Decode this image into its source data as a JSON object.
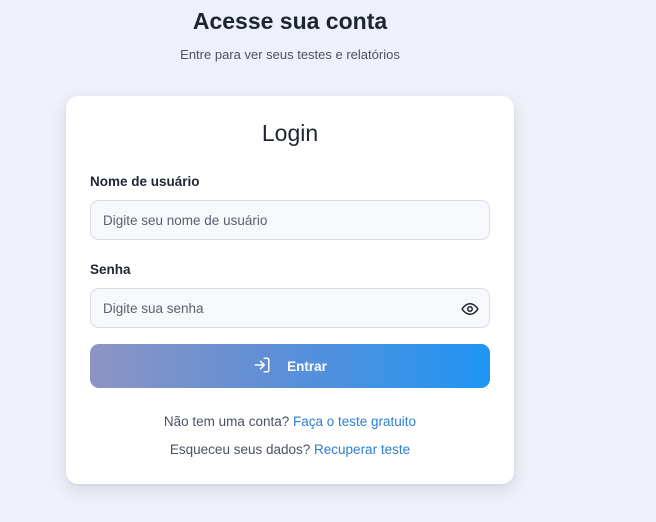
{
  "header": {
    "title": "Acesse sua conta",
    "subtitle": "Entre para ver seus testes e relatórios"
  },
  "login_card": {
    "title": "Login",
    "username": {
      "label": "Nome de usuário",
      "placeholder": "Digite seu nome de usuário",
      "value": ""
    },
    "password": {
      "label": "Senha",
      "placeholder": "Digite sua senha",
      "value": "",
      "toggle_icon": "eye-icon"
    },
    "submit": {
      "label": "Entrar",
      "icon": "login-icon"
    },
    "signup": {
      "prompt": "Não tem uma conta?",
      "link": "Faça o teste gratuito"
    },
    "recover": {
      "prompt": "Esqueceu seus dados?",
      "link": "Recuperar teste"
    }
  },
  "colors": {
    "background": "#eef1f9",
    "card": "#ffffff",
    "link": "#2b7fd4",
    "button_gradient_start": "#8e94c4",
    "button_gradient_end": "#1f95f3"
  }
}
